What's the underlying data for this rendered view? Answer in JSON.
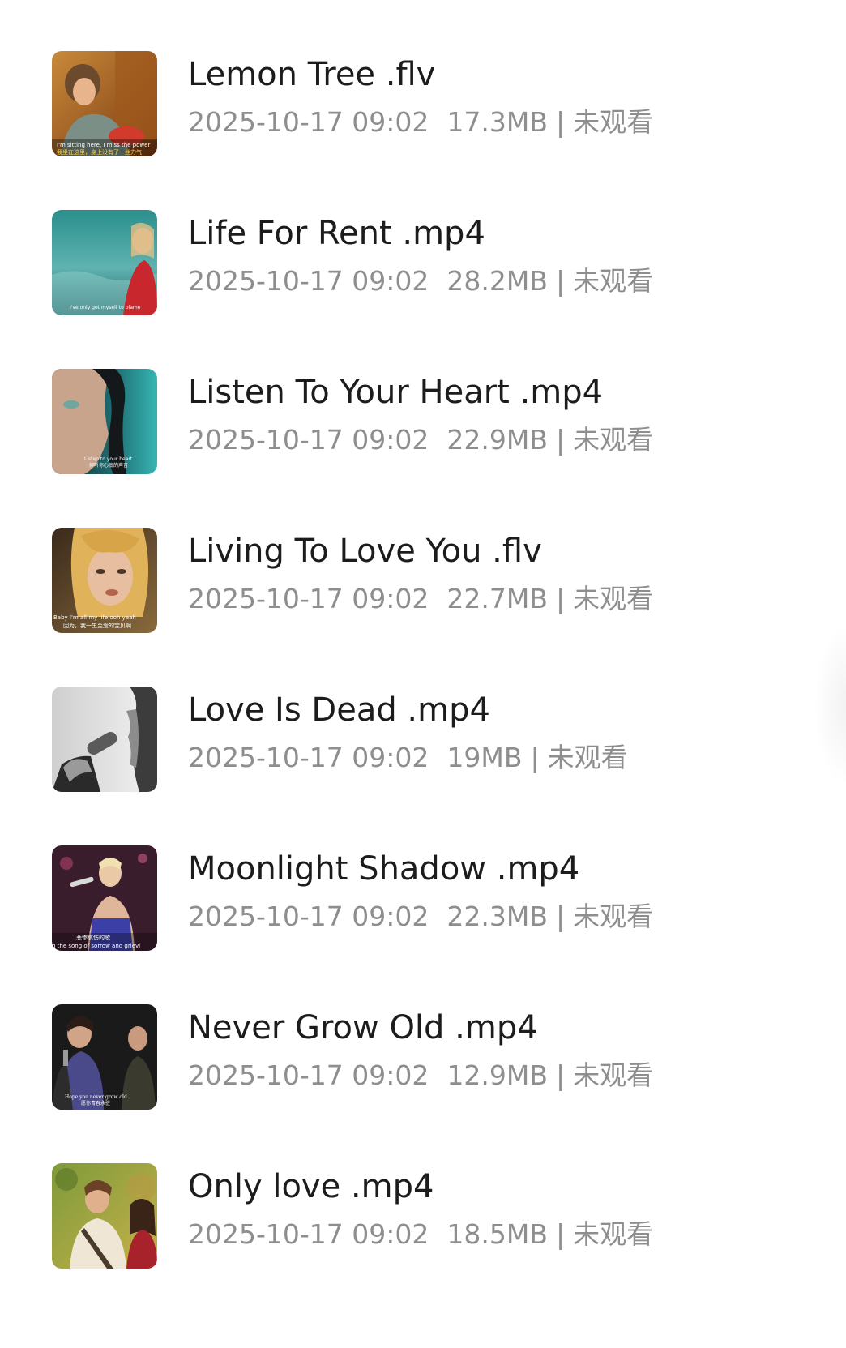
{
  "videos": [
    {
      "title": "Lemon Tree .flv",
      "date": "2025-10-17 09:02",
      "size": "17.3MB",
      "status": "未观看",
      "thumbnail": "man-in-car-warm-orange",
      "caption": "I'm sitting here, I miss the power"
    },
    {
      "title": "Life For Rent .mp4",
      "date": "2025-10-17 09:02",
      "size": "28.2MB",
      "status": "未观看",
      "thumbnail": "woman-red-dress-teal-water",
      "caption": ""
    },
    {
      "title": "Listen To Your Heart .mp4",
      "date": "2025-10-17 09:02",
      "size": "22.9MB",
      "status": "未观看",
      "thumbnail": "woman-closeup-dark-teal",
      "caption": "Listen to your heart"
    },
    {
      "title": "Living To Love You .flv",
      "date": "2025-10-17 09:02",
      "size": "22.7MB",
      "status": "未观看",
      "thumbnail": "blonde-woman-closeup",
      "caption": "Baby I'm all my life ooh yeah"
    },
    {
      "title": "Love Is Dead .mp4",
      "date": "2025-10-17 09:02",
      "size": "19MB",
      "status": "未观看",
      "thumbnail": "grayscale-singer-microphone",
      "caption": ""
    },
    {
      "title": "Moonlight Shadow .mp4",
      "date": "2025-10-17 09:02",
      "size": "22.3MB",
      "status": "未观看",
      "thumbnail": "singer-on-stage-purple",
      "caption": "...g the song of sorrow and grievi..."
    },
    {
      "title": "Never Grow Old .mp4",
      "date": "2025-10-17 09:02",
      "size": "12.9MB",
      "status": "未观看",
      "thumbnail": "band-dark-stage",
      "caption": "Hope you never grow old"
    },
    {
      "title": "Only love .mp4",
      "date": "2025-10-17 09:02",
      "size": "18.5MB",
      "status": "未观看",
      "thumbnail": "couple-green-outdoors",
      "caption": ""
    }
  ],
  "separator": "|"
}
